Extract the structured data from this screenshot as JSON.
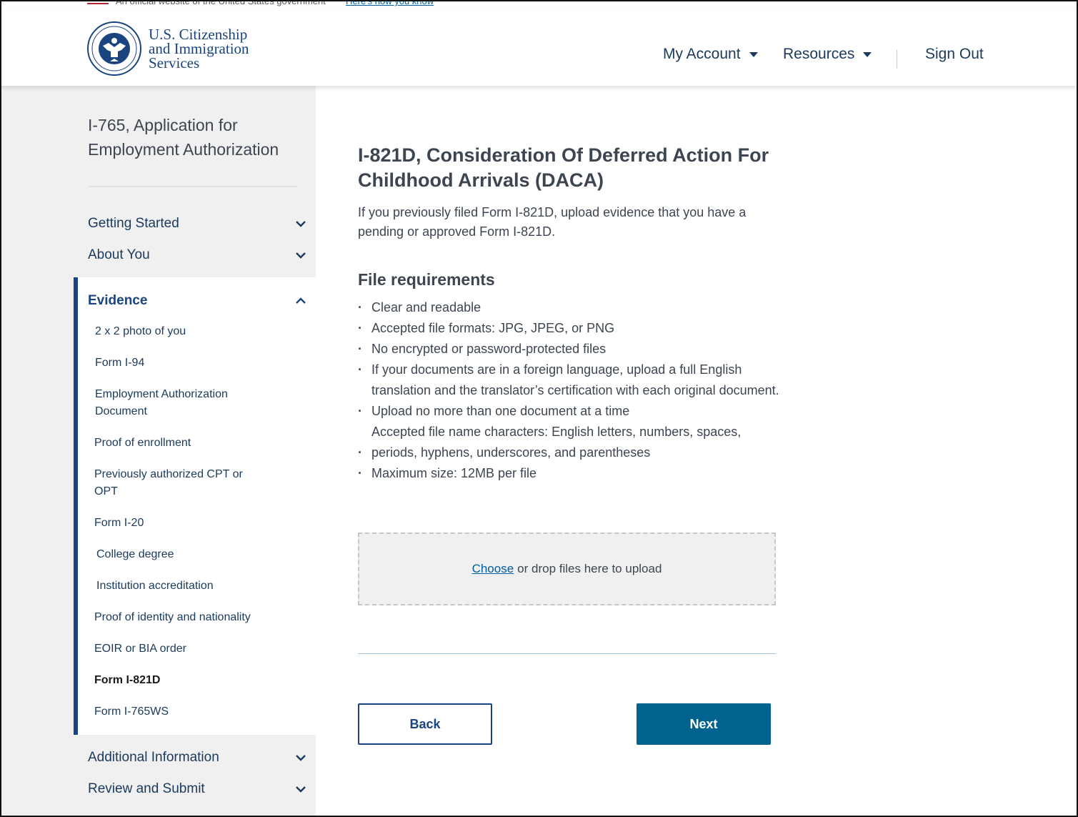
{
  "gov_banner": {
    "text": "An official website of the United States government",
    "link": "Here's how you know"
  },
  "header": {
    "brand_line1": "U.S. Citizenship",
    "brand_line2": "and Immigration",
    "brand_line3": "Services",
    "seal_icon": "dhs-seal-icon",
    "nav_account": "My Account",
    "nav_resources": "Resources",
    "nav_signout": "Sign Out"
  },
  "sidebar": {
    "title": "I-765, Application for Employment Authorization",
    "sections": {
      "getting_started": "Getting Started",
      "about_you": "About You",
      "evidence": "Evidence",
      "additional_information": "Additional Information",
      "review_submit": "Review and Submit"
    },
    "evidence_items": [
      "2 x 2 photo of you",
      "Form I-94",
      "Employment Authorization Document",
      "Proof of enrollment",
      "Previously authorized CPT or OPT",
      "Form I-20",
      "College degree",
      "Institution accreditation",
      "Proof of identity and nationality",
      "EOIR or BIA order",
      "Form I-821D",
      "Form I-765WS"
    ],
    "active_item": "Form I-821D"
  },
  "main": {
    "title": "I-821D, Consideration Of Deferred Action For Childhood Arrivals (DACA)",
    "intro": "If you previously filed Form I-821D, upload evidence that you have a pending or approved Form I-821D.",
    "requirements_title": "File requirements",
    "requirements": [
      "Clear and readable",
      "Accepted file formats: JPG, JPEG, or PNG",
      "No encrypted or password-protected files",
      "If your documents are in a foreign language,  upload a full English translation and the translator’s certification with each original document.",
      "Upload no more than one document at a time",
      "Accepted file name characters: English letters, numbers, spaces,",
      "periods, hyphens, underscores, and parentheses",
      "Maximum size: 12MB per file"
    ],
    "dropzone_choose": "Choose",
    "dropzone_text": "or drop files here to upload",
    "back_label": "Back",
    "next_label": "Next"
  },
  "colors": {
    "primary_dark": "#1a4480",
    "button_blue": "#00628f",
    "link_blue": "#005ea2",
    "sidebar_bg": "#f0f0f0"
  }
}
